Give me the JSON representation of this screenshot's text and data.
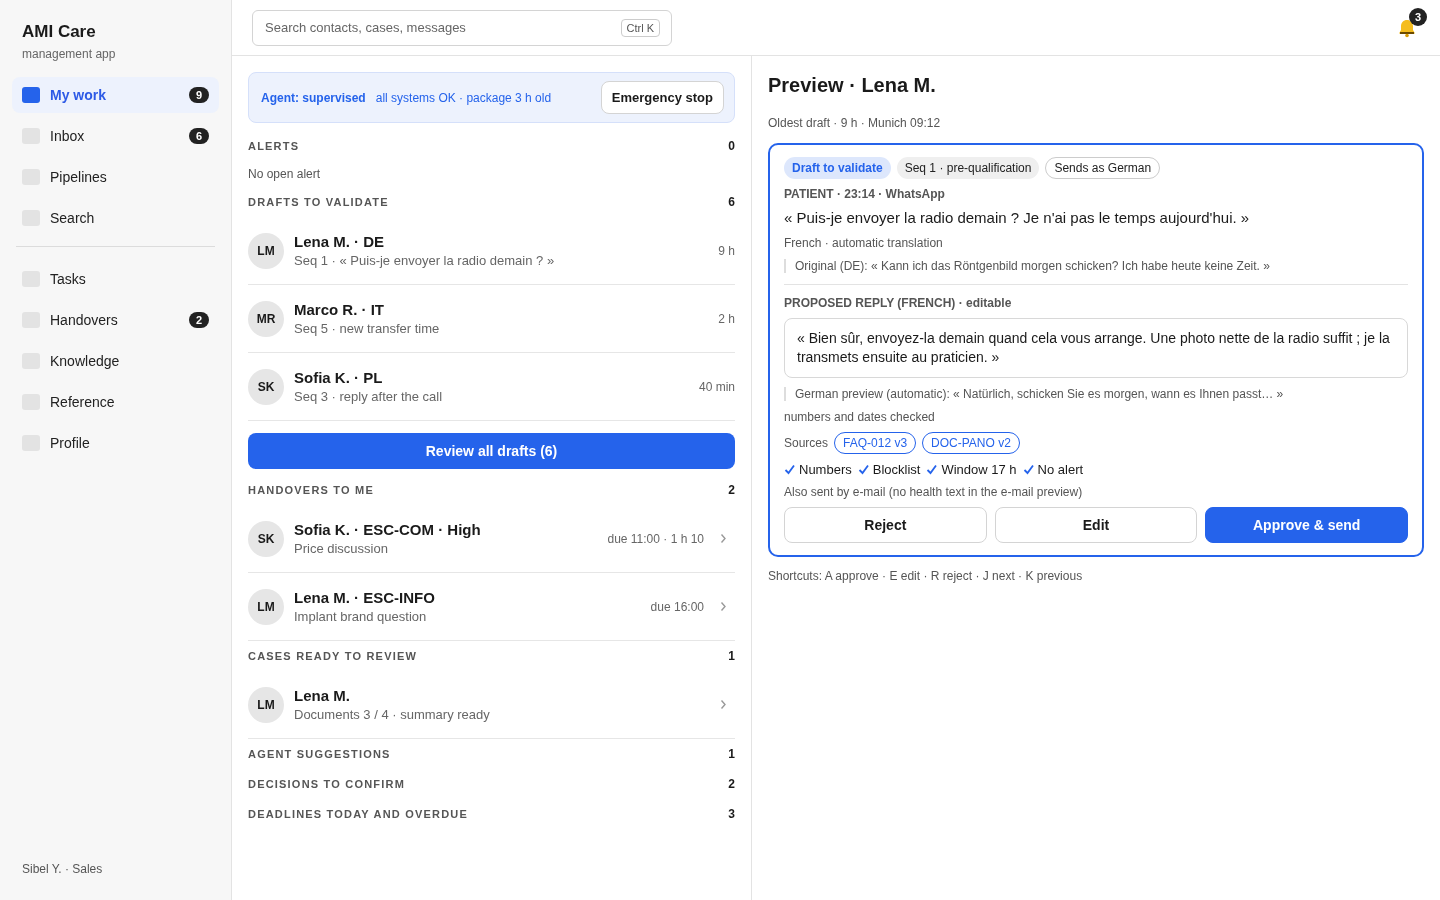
{
  "app": {
    "title": "AMI Care",
    "subtitle": "management app"
  },
  "sidebar": {
    "groups": [
      [
        {
          "label": "My work",
          "selected": true,
          "badge": "9"
        },
        {
          "label": "Inbox",
          "selected": false,
          "badge": "6"
        },
        {
          "label": "Pipelines",
          "selected": false
        },
        {
          "label": "Search",
          "selected": false
        }
      ],
      [
        {
          "label": "Tasks",
          "selected": false
        },
        {
          "label": "Handovers",
          "selected": false,
          "badge": "2"
        },
        {
          "label": "Knowledge",
          "selected": false
        },
        {
          "label": "Reference",
          "selected": false
        },
        {
          "label": "Profile",
          "selected": false
        }
      ]
    ],
    "user": "Sibel Y. · Sales"
  },
  "search": {
    "placeholder": "Search contacts, cases, messages",
    "shortcut": "Ctrl K"
  },
  "notifications": {
    "count": "3"
  },
  "status_banner": {
    "agent": "Agent: supervised",
    "detail": "all systems OK · package 3 h old",
    "button": "Emergency stop"
  },
  "sections": [
    {
      "title": "ALERTS",
      "count": "0",
      "empty_text": "No open alert"
    },
    {
      "title": "DRAFTS TO VALIDATE",
      "count": "6",
      "items": [
        {
          "initials": "LM",
          "title": "Lena M. · DE",
          "subtitle": "Seq 1 · « Puis-je envoyer la radio demain ? »",
          "meta": "9 h",
          "chevron": false
        },
        {
          "initials": "MR",
          "title": "Marco R. · IT",
          "subtitle": "Seq 5 · new transfer time",
          "meta": "2 h",
          "chevron": false
        },
        {
          "initials": "SK",
          "title": "Sofia K. · PL",
          "subtitle": "Seq 3 · reply after the call",
          "meta": "40 min",
          "chevron": false
        }
      ],
      "action": "Review all drafts (6)"
    },
    {
      "title": "HANDOVERS TO ME",
      "count": "2",
      "items": [
        {
          "initials": "SK",
          "title": "Sofia K. · ESC-COM · High",
          "subtitle": "Price discussion",
          "meta": "due 11:00 · 1 h 10",
          "chevron": true
        },
        {
          "initials": "LM",
          "title": "Lena M. · ESC-INFO",
          "subtitle": "Implant brand question",
          "meta": "due 16:00",
          "chevron": true
        }
      ]
    },
    {
      "title": "CASES READY TO REVIEW",
      "count": "1",
      "items": [
        {
          "initials": "LM",
          "title": "Lena M.",
          "subtitle": "Documents 3 / 4 · summary ready",
          "chevron": true
        }
      ]
    },
    {
      "title": "AGENT SUGGESTIONS",
      "count": "1"
    },
    {
      "title": "DECISIONS TO CONFIRM",
      "count": "2"
    },
    {
      "title": "DEADLINES TODAY AND OVERDUE",
      "count": "3"
    }
  ],
  "preview": {
    "title": "Preview · Lena M.",
    "subtitle": "Oldest draft · 9 h · Munich 09:12",
    "tags": [
      {
        "label": "Draft to validate",
        "kind": "status"
      },
      {
        "label": "Seq 1 · pre-qualification",
        "kind": "neutral"
      },
      {
        "label": "Sends as German",
        "kind": "outline"
      }
    ],
    "message_meta": "PATIENT · 23:14 · WhatsApp",
    "message": "« Puis-je envoyer la radio demain ? Je n'ai pas le temps aujourd'hui. »",
    "translation_note": "French · automatic translation",
    "original": "Original (DE): « Kann ich das Röntgenbild morgen schicken? Ich habe heute keine Zeit. »",
    "reply_label": "PROPOSED REPLY (FRENCH) · editable",
    "reply": "« Bien sûr, envoyez-la demain quand cela vous arrange. Une photo nette de la radio suffit ; je la transmets ensuite au praticien. »",
    "german_preview": "German preview (automatic): « Natürlich, schicken Sie es morgen, wann es Ihnen passt… »",
    "check_note": "numbers and dates checked",
    "sources_label": "Sources",
    "sources": [
      "FAQ-012 v3",
      "DOC-PANO v2"
    ],
    "checks": [
      {
        "label": "Numbers",
        "checked": true
      },
      {
        "label": "Blocklist",
        "checked": true
      },
      {
        "label": "Window 17 h",
        "checked": true
      },
      {
        "label": "No alert",
        "checked": true
      }
    ],
    "email_note": "Also sent by e-mail (no health text in the e-mail preview)",
    "buttons": [
      {
        "label": "Reject",
        "kind": "secondary"
      },
      {
        "label": "Edit",
        "kind": "secondary"
      },
      {
        "label": "Approve & send",
        "kind": "primary"
      }
    ]
  },
  "shortcuts": "Shortcuts: A approve · E edit · R reject · J next · K previous"
}
